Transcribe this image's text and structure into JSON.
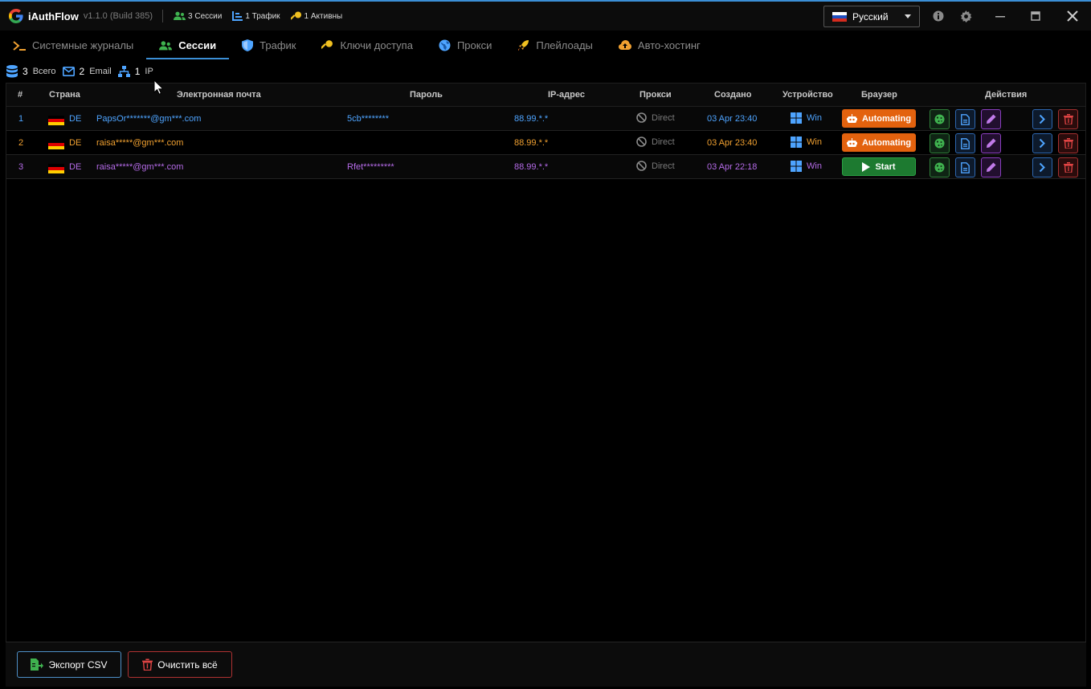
{
  "app": {
    "name": "iAuthFlow",
    "version": "v1.1.0 (Build 385)",
    "stats": [
      {
        "icon": "users-icon",
        "text": "3 Сессии",
        "color": "#3fb24f"
      },
      {
        "icon": "traffic-icon",
        "text": "1 Трафик",
        "color": "#4ea4ff"
      },
      {
        "icon": "key-icon",
        "text": "1 Активны",
        "color": "#f0c020"
      }
    ],
    "language": "Русский"
  },
  "tabs": [
    {
      "label": "Системные журналы",
      "icon": "terminal-icon",
      "active": false
    },
    {
      "label": "Сессии",
      "icon": "users-icon",
      "active": true
    },
    {
      "label": "Трафик",
      "icon": "shield-icon",
      "active": false
    },
    {
      "label": "Ключи доступа",
      "icon": "key-icon",
      "active": false
    },
    {
      "label": "Прокси",
      "icon": "globe-icon",
      "active": false
    },
    {
      "label": "Плейлоады",
      "icon": "rocket-icon",
      "active": false
    },
    {
      "label": "Авто-хостинг",
      "icon": "cloud-upload-icon",
      "active": false
    }
  ],
  "summary": {
    "total_num": "3",
    "total_label": "Всего",
    "email_num": "2",
    "email_label": "Email",
    "ip_num": "1",
    "ip_label": "IP"
  },
  "table": {
    "columns": [
      "#",
      "Страна",
      "Электронная почта",
      "Пароль",
      "IP-адрес",
      "Прокси",
      "Создано",
      "Устройство",
      "Браузер",
      "Действия"
    ],
    "rows": [
      {
        "index": "1",
        "country": "DE",
        "email": "PapsOr*******@gm***.com",
        "password": "5cb********",
        "ip": "88.99.*.*",
        "proxy": "Direct",
        "created": "03 Apr 23:40",
        "device": "Win",
        "browser": "Automating",
        "color": "#4ea4ff"
      },
      {
        "index": "2",
        "country": "DE",
        "email": "raisa*****@gm***.com",
        "password": "",
        "ip": "88.99.*.*",
        "proxy": "Direct",
        "created": "03 Apr 23:40",
        "device": "Win",
        "browser": "Automating",
        "color": "#f0a030"
      },
      {
        "index": "3",
        "country": "DE",
        "email": "raisa*****@gm***.com",
        "password": "Rfet*********",
        "ip": "88.99.*.*",
        "proxy": "Direct",
        "created": "03 Apr 22:18",
        "device": "Win",
        "browser": "Start",
        "color": "#b56be8"
      }
    ]
  },
  "footer": {
    "export_label": "Экспорт CSV",
    "clear_label": "Очистить всё"
  },
  "colors": {
    "accent": "#3b8fd6",
    "automating": "#e3620e",
    "start": "#1d7a30",
    "danger": "#b03232"
  }
}
